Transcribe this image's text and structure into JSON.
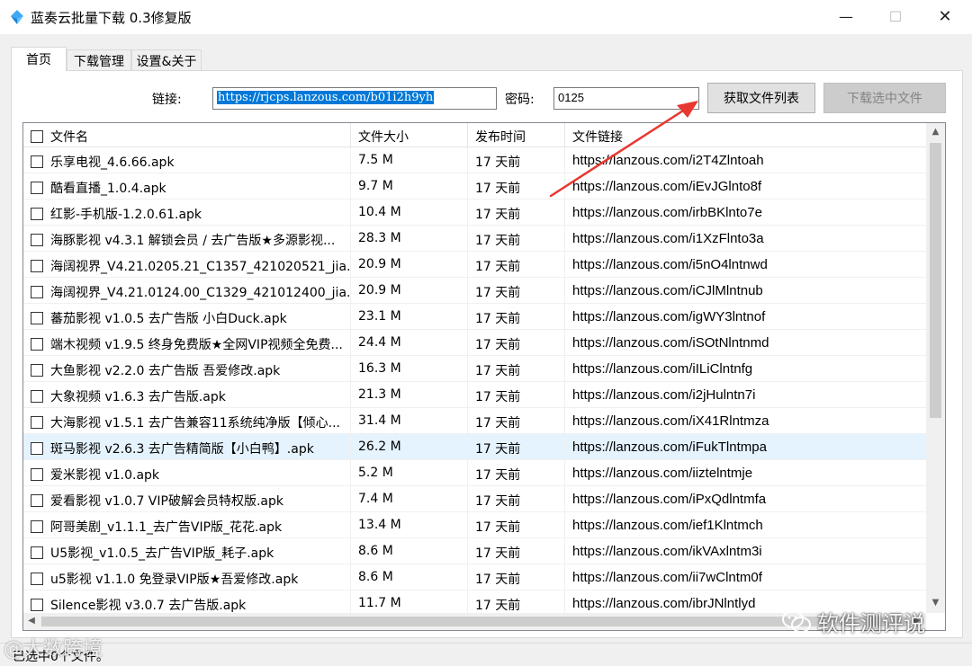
{
  "window": {
    "title": "蓝奏云批量下载 0.3修复版",
    "minimize_glyph": "—",
    "maximize_glyph": "☐",
    "close_glyph": "✕"
  },
  "tabs": [
    {
      "label": "首页",
      "active": true
    },
    {
      "label": "下载管理",
      "active": false
    },
    {
      "label": "设置&关于",
      "active": false
    }
  ],
  "form": {
    "link_label": "链接:",
    "link_value": "https://rjcps.lanzous.com/b01i2h9yh",
    "password_label": "密码:",
    "password_value": "0125",
    "fetch_button": "获取文件列表",
    "download_button": "下载选中文件"
  },
  "table": {
    "headers": {
      "name": "文件名",
      "size": "文件大小",
      "time": "发布时间",
      "url": "文件链接"
    },
    "rows": [
      {
        "name": "乐享电视_4.6.66.apk",
        "size": "7.5 M",
        "time": "17 天前",
        "url": "https://lanzous.com/i2T4Zlntoah"
      },
      {
        "name": "酷看直播_1.0.4.apk",
        "size": "9.7 M",
        "time": "17 天前",
        "url": "https://lanzous.com/iEvJGlnto8f"
      },
      {
        "name": "红影-手机版-1.2.0.61.apk",
        "size": "10.4 M",
        "time": "17 天前",
        "url": "https://lanzous.com/irbBKlnto7e"
      },
      {
        "name": "海豚影视 v4.3.1 解锁会员 / 去广告版★多源影视...",
        "size": "28.3 M",
        "time": "17 天前",
        "url": "https://lanzous.com/i1XzFlnto3a"
      },
      {
        "name": "海阔视界_V4.21.0205.21_C1357_421020521_jia...",
        "size": "20.9 M",
        "time": "17 天前",
        "url": "https://lanzous.com/i5nO4lntnwd"
      },
      {
        "name": "海阔视界_V4.21.0124.00_C1329_421012400_jia...",
        "size": "20.9 M",
        "time": "17 天前",
        "url": "https://lanzous.com/iCJlMlntnub"
      },
      {
        "name": "蕃茄影视 v1.0.5 去广告版 小白Duck.apk",
        "size": "23.1 M",
        "time": "17 天前",
        "url": "https://lanzous.com/igWY3lntnof"
      },
      {
        "name": "端木视频 v1.9.5 终身免费版★全网VIP视频全免费...",
        "size": "24.4 M",
        "time": "17 天前",
        "url": "https://lanzous.com/iSOtNlntnmd"
      },
      {
        "name": "大鱼影视 v2.2.0 去广告版 吾爱修改.apk",
        "size": "16.3 M",
        "time": "17 天前",
        "url": "https://lanzous.com/iILiClntnfg"
      },
      {
        "name": "大象视频 v1.6.3 去广告版.apk",
        "size": "21.3 M",
        "time": "17 天前",
        "url": "https://lanzous.com/i2jHulntn7i"
      },
      {
        "name": "大海影视 v1.5.1 去广告兼容11系统纯净版【倾心...",
        "size": "31.4 M",
        "time": "17 天前",
        "url": "https://lanzous.com/iX41Rlntmza"
      },
      {
        "name": "斑马影视 v2.6.3 去广告精简版【小白鸭】.apk",
        "size": "26.2 M",
        "time": "17 天前",
        "url": "https://lanzous.com/iFukTlntmpa"
      },
      {
        "name": "爱米影视 v1.0.apk",
        "size": "5.2 M",
        "time": "17 天前",
        "url": "https://lanzous.com/iiztelntmje"
      },
      {
        "name": "爱看影视 v1.0.7 VIP破解会员特权版.apk",
        "size": "7.4 M",
        "time": "17 天前",
        "url": "https://lanzous.com/iPxQdlntmfa"
      },
      {
        "name": "阿哥美剧_v1.1.1_去广告VIP版_花花.apk",
        "size": "13.4 M",
        "time": "17 天前",
        "url": "https://lanzous.com/ief1Klntmch"
      },
      {
        "name": "U5影视_v1.0.5_去广告VIP版_耗子.apk",
        "size": "8.6 M",
        "time": "17 天前",
        "url": "https://lanzous.com/ikVAxlntm3i"
      },
      {
        "name": "u5影视 v1.1.0 免登录VIP版★吾爱修改.apk",
        "size": "8.6 M",
        "time": "17 天前",
        "url": "https://lanzous.com/ii7wClntm0f"
      },
      {
        "name": "Silence影视 v3.0.7 去广告版.apk",
        "size": "11.7 M",
        "time": "17 天前",
        "url": "https://lanzous.com/ibrJNlntlyd"
      }
    ],
    "highlighted_row": 11
  },
  "status": {
    "text": "已选中0个文件。"
  },
  "watermarks": {
    "left": "@大数跨境",
    "right": "软件测评说"
  },
  "colors": {
    "annotation_arrow": "#e8382f",
    "selection": "#0078d7",
    "row_highlight": "#e5f3ff"
  }
}
